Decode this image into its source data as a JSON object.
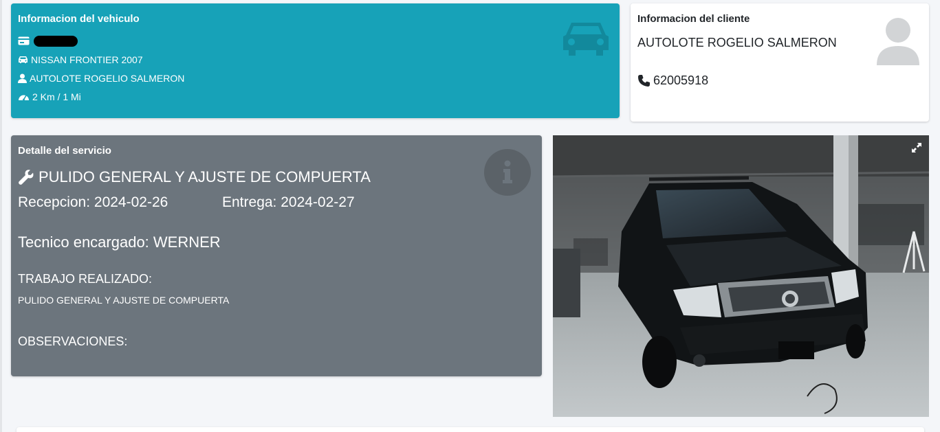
{
  "vehicle": {
    "title": "Informacion del vehiculo",
    "model": "NISSAN FRONTIER 2007",
    "owner": "AUTOLOTE ROGELIO SALMERON",
    "mileage": "2 Km / 1 Mi",
    "plate_icon": "id-card-icon",
    "model_icon": "car-icon",
    "owner_icon": "user-icon",
    "mileage_icon": "tachometer-icon",
    "accent": "#17a2b8"
  },
  "client": {
    "title": "Informacion del cliente",
    "name": "AUTOLOTE ROGELIO SALMERON",
    "phone": "62005918",
    "avatar_icon": "user-avatar-icon",
    "phone_icon": "phone-icon"
  },
  "service": {
    "title": "Detalle del servicio",
    "name": "PULIDO GENERAL Y AJUSTE DE COMPUERTA",
    "reception": "Recepcion: 2024-02-26",
    "delivery": "Entrega: 2024-02-27",
    "technician": "Tecnico encargado: WERNER",
    "work_label": "TRABAJO REALIZADO:",
    "work_done": "PULIDO GENERAL Y AJUSTE DE COMPUERTA",
    "observations_label": "OBSERVACIONES:",
    "icon": "wrench-icon",
    "accent": "#6c757d"
  },
  "photo": {
    "subject": "vehicle-photo",
    "expand_icon": "expand-icon"
  }
}
